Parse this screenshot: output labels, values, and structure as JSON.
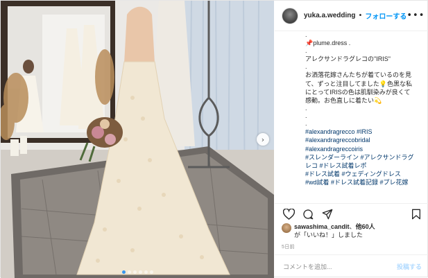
{
  "header": {
    "username": "yuka.a.wedding",
    "separator": "•",
    "follow_label": "フォローする",
    "more_label": "•••"
  },
  "caption": {
    "lines": [
      ".",
      "📌plume.dress .",
      ".",
      "アレクサンドラグレコの\"IRIS\"",
      ".",
      "お洒落花嫁さんたちが着ているのを見",
      "て、ずっと注目してました💡色黒な私",
      "にとってIRISの色は肌馴染みが良くて",
      "感動。お色直しに着たい💫",
      ".",
      ".",
      ".",
      "#alexandragrecco #IRIS",
      "#alexandragreccobridal",
      "#alexandragreccoiris",
      "#スレンダーライン #アレクサンドラグ",
      "レコ #ドレス試着レポ",
      "#ドレス試着 #ウェディングドレス",
      "#wd試着 #ドレス試着記録 #プレ花嫁"
    ]
  },
  "likes": {
    "username": "sawashima_candit",
    "others": "他60人",
    "suffix": "が「いいね！」しました"
  },
  "time_ago": "5日前",
  "comment": {
    "placeholder": "コメントを追加...",
    "post_label": "投稿する"
  },
  "icons": {
    "heart": "heart-icon",
    "comment": "comment-icon",
    "share": "share-icon",
    "bookmark": "bookmark-icon",
    "next": "chevron-right-icon"
  },
  "colors": {
    "accent": "#0095f6",
    "text": "#262626",
    "muted": "#8e8e8e",
    "hashtag": "#00376b"
  },
  "carousel": {
    "slide_count": 6,
    "active_slide": 1
  }
}
